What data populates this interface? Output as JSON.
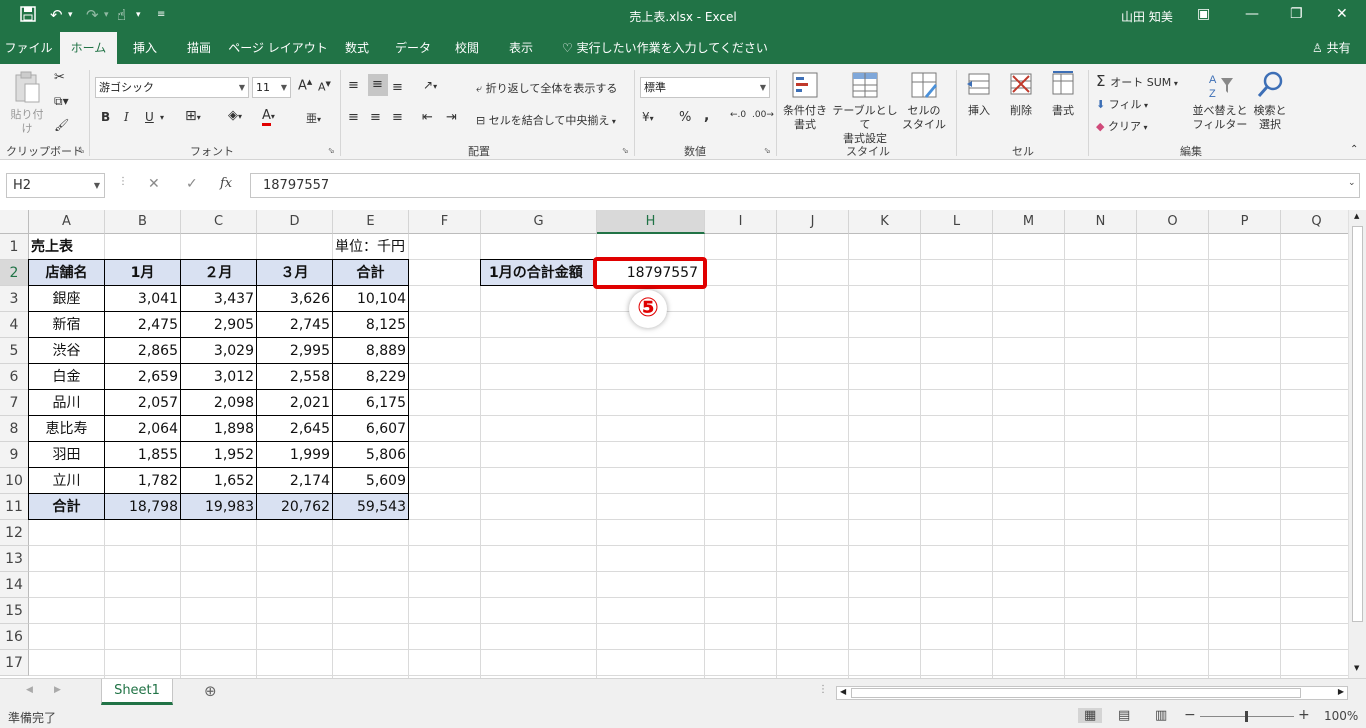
{
  "titlebar": {
    "title": "売上表.xlsx  -  Excel",
    "user": "山田 知美"
  },
  "tabs": [
    "ファイル",
    "ホーム",
    "挿入",
    "描画",
    "ページ レイアウト",
    "数式",
    "データ",
    "校閲",
    "表示"
  ],
  "tell_me": "実行したい作業を入力してください",
  "share": "共有",
  "ribbon": {
    "clipboard": {
      "paste": "貼り付け",
      "label": "クリップボード"
    },
    "font": {
      "name": "游ゴシック",
      "size": "11",
      "bold": "B",
      "italic": "I",
      "underline": "U",
      "label": "フォント"
    },
    "alignment": {
      "wrap": "折り返して全体を表示する",
      "merge": "セルを結合して中央揃え",
      "label": "配置"
    },
    "number": {
      "format": "標準",
      "percent": "%",
      "comma": ",",
      "label": "数値"
    },
    "styles": {
      "conditional": [
        "条件付き",
        "書式"
      ],
      "table": [
        "テーブルとして",
        "書式設定"
      ],
      "cell": [
        "セルの",
        "スタイル"
      ],
      "label": "スタイル"
    },
    "cells": {
      "insert": "挿入",
      "delete": "削除",
      "format": "書式",
      "label": "セル"
    },
    "editing": {
      "autosum": "オート SUM",
      "fill": "フィル",
      "clear": "クリア",
      "sort": [
        "並べ替えと",
        "フィルター"
      ],
      "find": [
        "検索と",
        "選択"
      ],
      "label": "編集"
    }
  },
  "formula_bar": {
    "name_box": "H2",
    "fx": "fx",
    "content": "18797557"
  },
  "columns": [
    "A",
    "B",
    "C",
    "D",
    "E",
    "F",
    "G",
    "H",
    "I",
    "J",
    "K",
    "L",
    "M",
    "N",
    "O",
    "P",
    "Q"
  ],
  "rows": [
    "1",
    "2",
    "3",
    "4",
    "5",
    "6",
    "7",
    "8",
    "9",
    "10",
    "11",
    "12",
    "13",
    "14",
    "15",
    "16",
    "17"
  ],
  "selected_cell": {
    "column": "H",
    "row": "2"
  },
  "cells": {
    "A1": "売上表",
    "E1": "単位：千円",
    "header": [
      "店舗名",
      "1月",
      "２月",
      "３月",
      "合計"
    ],
    "data": [
      [
        "銀座",
        "3,041",
        "3,437",
        "3,626",
        "10,104"
      ],
      [
        "新宿",
        "2,475",
        "2,905",
        "2,745",
        "8,125"
      ],
      [
        "渋谷",
        "2,865",
        "3,029",
        "2,995",
        "8,889"
      ],
      [
        "白金",
        "2,659",
        "3,012",
        "2,558",
        "8,229"
      ],
      [
        "品川",
        "2,057",
        "2,098",
        "2,021",
        "6,175"
      ],
      [
        "恵比寿",
        "2,064",
        "1,898",
        "2,645",
        "6,607"
      ],
      [
        "羽田",
        "1,855",
        "1,952",
        "1,999",
        "5,806"
      ],
      [
        "立川",
        "1,782",
        "1,652",
        "2,174",
        "5,609"
      ]
    ],
    "total": [
      "合計",
      "18,798",
      "19,983",
      "20,762",
      "59,543"
    ],
    "G2": "1月の合計金額",
    "H2": "18797557"
  },
  "annotation": "⑤",
  "sheet_tab": "Sheet1",
  "status": {
    "ready": "準備完了",
    "zoom": "100%"
  },
  "colors": {
    "excel_green": "#217346",
    "header_fill": "#d9e1f2",
    "highlight_red": "#e00000"
  }
}
